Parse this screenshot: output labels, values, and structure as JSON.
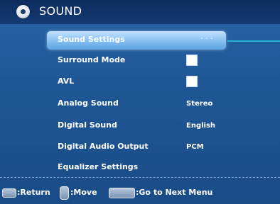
{
  "header": {
    "title": "SOUND",
    "icon": "speaker-disc-icon"
  },
  "menu": {
    "items": [
      {
        "label": "Sound Settings",
        "value": ". . .",
        "selected": true
      },
      {
        "label": "Surround Mode",
        "control": "checkbox"
      },
      {
        "label": "AVL",
        "control": "checkbox"
      },
      {
        "label": "Analog Sound",
        "value": "Stereo"
      },
      {
        "label": "Digital Sound",
        "value": "English"
      },
      {
        "label": "Digital Audio Output",
        "value": "PCM"
      },
      {
        "label": "Equalizer Settings"
      }
    ]
  },
  "footer": {
    "return_label": ":Return",
    "move_label": ":Move",
    "next_label": ":Go to Next Menu",
    "return_icon": "menu-key-icon",
    "move_icon": "up-down-keys-icon",
    "next_icon": "ok-right-key-icon"
  },
  "colors": {
    "background": "#1f5796",
    "header": "#0d2c5e",
    "highlight": "#8fc4f4",
    "pointer_line": "#27b2d4",
    "text": "#ffffff"
  }
}
